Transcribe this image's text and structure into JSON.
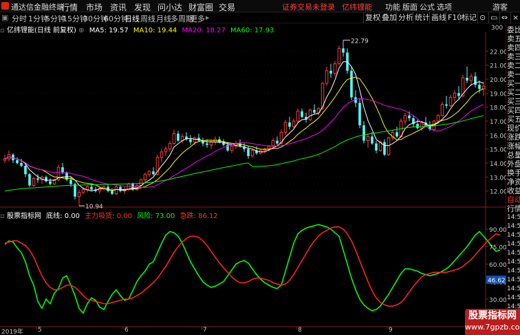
{
  "menubar": {
    "app_title": "通达信金融终端",
    "menus": [
      "行情",
      "市场",
      "资讯",
      "发现",
      "问小达",
      "财富圈",
      "交易"
    ],
    "warning": "证券交易未登录",
    "brand": "亿纬锂能",
    "right_menus": [
      "功能",
      "版面",
      "公式",
      "选项"
    ],
    "guest": "游客"
  },
  "periodbar": {
    "periods": [
      "分时",
      "1分钟",
      "5分钟",
      "15分钟",
      "30分钟",
      "60分钟",
      "日线",
      "周线",
      "月线",
      "多周期",
      "更多"
    ],
    "active": "日线",
    "right_buttons": [
      "复权",
      "叠加",
      "分析",
      "统计",
      "画线",
      "F10",
      "标记"
    ]
  },
  "stock_info": {
    "name": "亿纬锂能(日线 前复权)",
    "ma": [
      {
        "label": "MA5: 19.57",
        "color": "#ffffff"
      },
      {
        "label": "MA10: 19.44",
        "color": "#ffff00"
      },
      {
        "label": "MA20: 18.27",
        "color": "#ff00ff"
      },
      {
        "label": "MA60: 17.93",
        "color": "#00ff00"
      }
    ]
  },
  "indicator_info": {
    "name": "股票指标网",
    "items": [
      {
        "label": "底线: 0.00",
        "color": "#ffffff"
      },
      {
        "label": "主力吸货: 0.00",
        "color": "#ff3333"
      },
      {
        "label": "风险: 73.00",
        "color": "#00ff00"
      },
      {
        "label": "急跌: 86.12",
        "color": "#ff3333"
      }
    ]
  },
  "right_panel": [
    "委比",
    "卖五",
    "卖四",
    "卖三",
    "卖二",
    "卖一",
    "买一",
    "买二",
    "买三",
    "买四",
    "买五",
    "现价",
    "涨跌",
    "涨幅",
    "总量",
    "外盘",
    "换手",
    "净资",
    "收益",
    "自动",
    "行情",
    "14:50",
    "14:50",
    "14:50",
    "14:50",
    "14:50",
    "14:50",
    "14:50",
    "14:50",
    "14:50",
    "14:50",
    "14:50"
  ],
  "watermark": {
    "line1": "股票指标网",
    "line2": "www.7gpzb.com"
  },
  "dates": [
    {
      "label": "2019年",
      "i": 0
    },
    {
      "label": "5",
      "i": 8
    },
    {
      "label": "6",
      "i": 29
    },
    {
      "label": "7",
      "i": 48
    },
    {
      "label": "8",
      "i": 71
    },
    {
      "label": "9",
      "i": 93
    },
    {
      "label": "10",
      "i": 112
    },
    {
      "label": "11",
      "i": 128
    }
  ],
  "chart_data": {
    "type": "candlestick",
    "price_axis": [
      22,
      21,
      20,
      19,
      18,
      17,
      16,
      15,
      14,
      13,
      12
    ],
    "price_axis_top_label": "300",
    "ylim": [
      11.0,
      23.2
    ],
    "high_label": "22.79",
    "low_label": "10.94",
    "indicator_axis": [
      90.0,
      75.0,
      60.0,
      45.0,
      30.0,
      15.0
    ],
    "indicator_current": "46.62",
    "indicator_ylim": [
      8,
      99
    ],
    "candles": [
      [
        14.2,
        14.6,
        14.0,
        14.3
      ],
      [
        14.3,
        14.9,
        14.1,
        14.6
      ],
      [
        14.6,
        14.7,
        14.0,
        14.2
      ],
      [
        14.2,
        14.4,
        13.9,
        14.0
      ],
      [
        14.0,
        14.3,
        13.7,
        13.8
      ],
      [
        13.8,
        14.0,
        13.0,
        13.2
      ],
      [
        13.2,
        13.3,
        12.3,
        12.4
      ],
      [
        12.4,
        13.0,
        12.3,
        12.9
      ],
      [
        12.9,
        13.2,
        12.6,
        12.8
      ],
      [
        12.8,
        13.1,
        12.5,
        13.0
      ],
      [
        13.0,
        13.1,
        12.6,
        12.7
      ],
      [
        12.7,
        12.9,
        12.4,
        12.5
      ],
      [
        12.5,
        12.9,
        12.4,
        12.8
      ],
      [
        12.8,
        13.9,
        12.7,
        13.7
      ],
      [
        13.7,
        14.0,
        13.2,
        13.3
      ],
      [
        13.3,
        13.4,
        12.7,
        12.8
      ],
      [
        12.8,
        13.0,
        12.3,
        12.5
      ],
      [
        12.5,
        12.6,
        11.4,
        11.6
      ],
      [
        11.6,
        12.1,
        10.94,
        11.9
      ],
      [
        11.9,
        12.3,
        11.8,
        12.1
      ],
      [
        12.1,
        12.4,
        11.9,
        12.3
      ],
      [
        12.3,
        12.5,
        12.0,
        12.1
      ],
      [
        12.1,
        12.3,
        11.9,
        12.0
      ],
      [
        12.0,
        12.3,
        11.8,
        12.2
      ],
      [
        12.2,
        12.4,
        12.0,
        12.3
      ],
      [
        12.3,
        12.5,
        11.9,
        12.0
      ],
      [
        12.0,
        12.2,
        11.7,
        11.8
      ],
      [
        11.8,
        12.5,
        11.7,
        12.3
      ],
      [
        12.3,
        12.4,
        11.9,
        12.0
      ],
      [
        12.0,
        12.3,
        11.8,
        12.1
      ],
      [
        12.1,
        12.6,
        12.0,
        12.5
      ],
      [
        12.5,
        12.6,
        12.0,
        12.1
      ],
      [
        12.1,
        12.5,
        12.0,
        12.4
      ],
      [
        12.4,
        12.9,
        12.3,
        12.8
      ],
      [
        12.8,
        13.3,
        12.6,
        13.2
      ],
      [
        13.2,
        13.5,
        13.0,
        13.4
      ],
      [
        13.4,
        13.7,
        13.1,
        13.2
      ],
      [
        13.2,
        14.6,
        13.1,
        14.4
      ],
      [
        14.4,
        15.0,
        14.1,
        14.8
      ],
      [
        14.8,
        15.2,
        14.5,
        15.0
      ],
      [
        15.0,
        15.6,
        14.8,
        15.4
      ],
      [
        15.4,
        16.4,
        15.3,
        16.1
      ],
      [
        16.1,
        16.3,
        15.5,
        15.6
      ],
      [
        15.6,
        16.1,
        15.4,
        15.9
      ],
      [
        15.9,
        16.2,
        15.6,
        15.7
      ],
      [
        15.7,
        16.0,
        15.3,
        15.5
      ],
      [
        15.5,
        15.9,
        15.3,
        15.8
      ],
      [
        15.8,
        16.1,
        15.5,
        15.6
      ],
      [
        15.6,
        15.8,
        15.2,
        15.4
      ],
      [
        15.4,
        15.7,
        15.1,
        15.3
      ],
      [
        15.3,
        15.6,
        15.0,
        15.5
      ],
      [
        15.5,
        15.9,
        15.3,
        15.7
      ],
      [
        15.7,
        15.9,
        15.4,
        15.5
      ],
      [
        15.5,
        15.7,
        15.2,
        15.3
      ],
      [
        15.3,
        15.5,
        14.8,
        14.9
      ],
      [
        14.9,
        15.3,
        14.7,
        15.2
      ],
      [
        15.2,
        15.6,
        15.0,
        15.4
      ],
      [
        15.4,
        15.7,
        15.1,
        15.2
      ],
      [
        15.2,
        15.4,
        14.8,
        15.0
      ],
      [
        15.0,
        15.2,
        14.3,
        14.5
      ],
      [
        14.5,
        15.0,
        14.4,
        14.9
      ],
      [
        14.9,
        15.2,
        14.6,
        14.7
      ],
      [
        14.7,
        15.0,
        14.6,
        14.9
      ],
      [
        14.9,
        15.1,
        14.7,
        15.0
      ],
      [
        15.0,
        15.3,
        14.8,
        15.2
      ],
      [
        15.2,
        15.8,
        15.0,
        15.6
      ],
      [
        15.6,
        15.9,
        15.3,
        15.4
      ],
      [
        15.4,
        16.4,
        15.3,
        16.2
      ],
      [
        16.2,
        17.1,
        16.0,
        16.9
      ],
      [
        16.9,
        17.3,
        16.4,
        16.6
      ],
      [
        16.6,
        17.2,
        16.5,
        17.0
      ],
      [
        17.0,
        17.9,
        16.9,
        17.7
      ],
      [
        17.7,
        17.9,
        17.2,
        17.3
      ],
      [
        17.3,
        17.6,
        16.9,
        17.1
      ],
      [
        17.1,
        17.9,
        17.0,
        17.8
      ],
      [
        17.8,
        18.2,
        17.5,
        17.6
      ],
      [
        17.6,
        18.0,
        17.4,
        17.9
      ],
      [
        17.9,
        19.8,
        17.8,
        19.7
      ],
      [
        19.7,
        20.9,
        19.5,
        20.6
      ],
      [
        20.6,
        21.1,
        20.1,
        20.4
      ],
      [
        20.4,
        21.3,
        20.2,
        21.1
      ],
      [
        21.1,
        22.4,
        21.0,
        22.2
      ],
      [
        22.2,
        22.79,
        21.6,
        21.9
      ],
      [
        21.9,
        22.2,
        20.4,
        20.6
      ],
      [
        20.6,
        20.9,
        18.5,
        18.7
      ],
      [
        18.7,
        19.2,
        18.0,
        18.3
      ],
      [
        18.3,
        18.6,
        16.5,
        16.7
      ],
      [
        16.7,
        17.0,
        15.4,
        15.6
      ],
      [
        15.6,
        16.1,
        15.1,
        15.9
      ],
      [
        15.9,
        16.2,
        15.3,
        15.4
      ],
      [
        15.4,
        15.6,
        14.7,
        14.9
      ],
      [
        14.9,
        15.6,
        14.8,
        15.5
      ],
      [
        15.5,
        15.7,
        14.5,
        14.6
      ],
      [
        14.6,
        15.9,
        14.5,
        15.8
      ],
      [
        15.8,
        16.4,
        15.6,
        16.2
      ],
      [
        16.2,
        16.6,
        15.8,
        15.9
      ],
      [
        15.9,
        17.2,
        15.8,
        17.0
      ],
      [
        17.0,
        17.6,
        16.7,
        17.4
      ],
      [
        17.4,
        17.7,
        17.0,
        17.2
      ],
      [
        17.2,
        17.4,
        16.6,
        16.8
      ],
      [
        16.8,
        17.1,
        16.4,
        16.5
      ],
      [
        16.5,
        17.0,
        16.3,
        16.9
      ],
      [
        16.9,
        17.3,
        16.6,
        16.7
      ],
      [
        16.7,
        17.0,
        16.3,
        16.4
      ],
      [
        16.4,
        17.1,
        16.3,
        17.0
      ],
      [
        17.0,
        17.5,
        16.8,
        17.4
      ],
      [
        17.4,
        18.4,
        17.3,
        18.2
      ],
      [
        18.2,
        18.8,
        17.9,
        18.1
      ],
      [
        18.1,
        18.9,
        18.0,
        18.7
      ],
      [
        18.7,
        19.2,
        18.4,
        19.0
      ],
      [
        19.0,
        19.5,
        18.6,
        18.8
      ],
      [
        18.8,
        20.3,
        18.7,
        20.1
      ],
      [
        20.1,
        20.9,
        19.7,
        19.9
      ],
      [
        19.9,
        20.4,
        19.5,
        20.2
      ],
      [
        20.2,
        20.5,
        19.4,
        19.6
      ],
      [
        19.6,
        19.9,
        19.0,
        19.3
      ],
      [
        19.3,
        19.8,
        18.8,
        19.5
      ]
    ],
    "ma_series": [
      {
        "name": "MA5",
        "color": "#ffffff",
        "period": 5
      },
      {
        "name": "MA10",
        "color": "#ffff00",
        "period": 10
      },
      {
        "name": "MA20",
        "color": "#ff00ff",
        "period": 20
      },
      {
        "name": "MA60",
        "color": "#00ff00",
        "period": 60
      }
    ],
    "indicator_series": [
      {
        "name": "风险",
        "color": "#00ff00",
        "values": [
          77,
          80,
          79,
          74,
          70,
          62,
          50,
          42,
          28,
          22,
          30,
          26,
          35,
          39,
          48,
          50,
          42,
          33,
          22,
          18,
          26,
          31,
          29,
          23,
          21,
          28,
          34,
          38,
          33,
          29,
          30,
          37,
          45,
          50,
          54,
          60,
          62,
          70,
          78,
          85,
          88,
          87,
          84,
          78,
          70,
          62,
          56,
          50,
          45,
          42,
          40,
          41,
          43,
          45,
          50,
          55,
          60,
          62,
          63,
          61,
          56,
          51,
          47,
          44,
          42,
          40,
          39,
          42,
          54,
          66,
          78,
          86,
          89,
          91,
          92,
          93,
          94,
          93,
          92,
          90,
          87,
          84,
          72,
          60,
          48,
          38,
          30,
          25,
          22,
          20,
          21,
          24,
          29,
          34,
          40,
          46,
          52,
          56,
          56,
          55,
          54,
          52,
          51,
          50,
          51,
          52,
          54,
          56,
          59,
          63,
          67,
          71,
          75,
          80,
          85,
          88,
          84,
          80,
          75,
          71,
          72
        ]
      },
      {
        "name": "急跌",
        "color": "#ff2222",
        "values": [
          78,
          79,
          80,
          80,
          78,
          76,
          72,
          66,
          58,
          50,
          44,
          40,
          38,
          38,
          40,
          42,
          42,
          40,
          37,
          33,
          30,
          29,
          28,
          27,
          26,
          26,
          27,
          28,
          29,
          30,
          30,
          31,
          33,
          35,
          38,
          41,
          44,
          48,
          53,
          58,
          64,
          70,
          75,
          79,
          82,
          84,
          84,
          83,
          80,
          76,
          71,
          66,
          61,
          57,
          53,
          49,
          46,
          44,
          44,
          45,
          47,
          48,
          48,
          47,
          46,
          44,
          43,
          42,
          43,
          46,
          51,
          57,
          63,
          69,
          75,
          80,
          84,
          87,
          89,
          91,
          92,
          92,
          90,
          86,
          80,
          72,
          63,
          54,
          45,
          37,
          31,
          27,
          25,
          24,
          24,
          25,
          27,
          31,
          36,
          41,
          45,
          49,
          51,
          52,
          53,
          53,
          53,
          53,
          54,
          55,
          56,
          58,
          61,
          64,
          68,
          72,
          76,
          80,
          83,
          86,
          85
        ]
      }
    ]
  }
}
